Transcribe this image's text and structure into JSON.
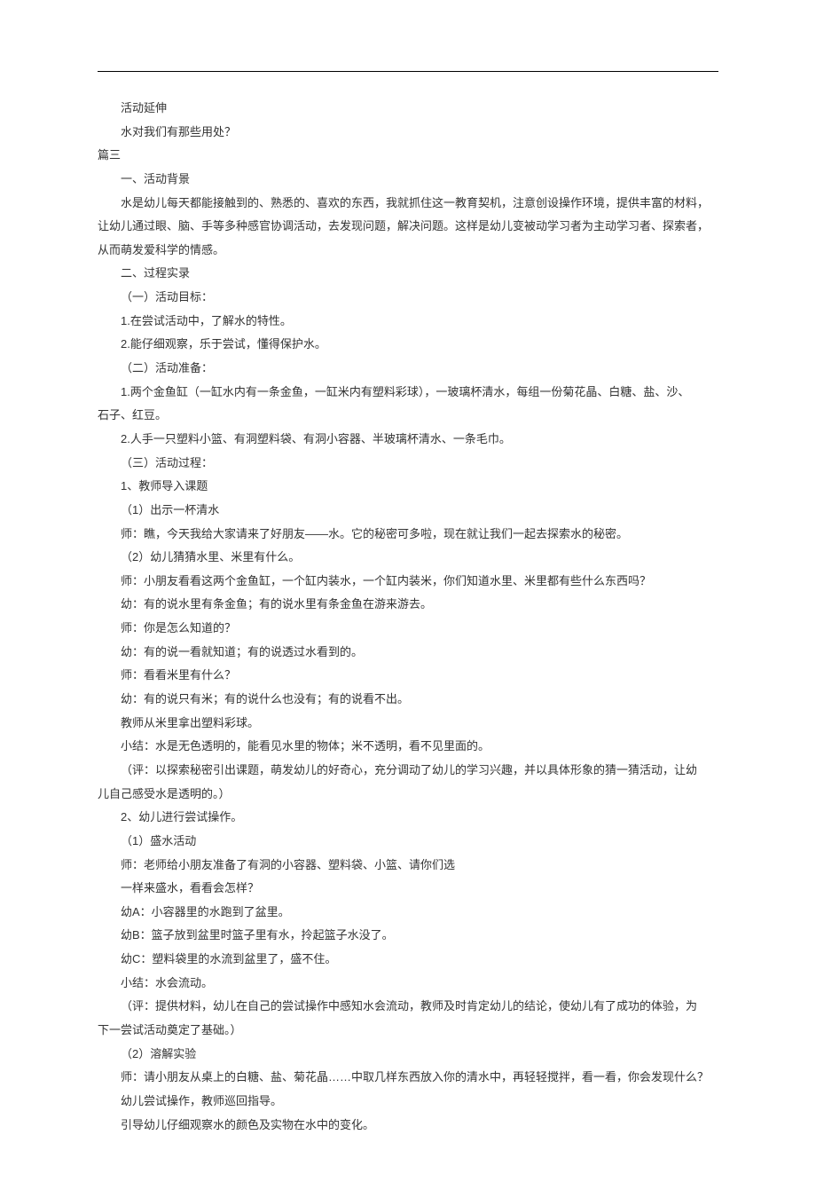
{
  "lines": [
    {
      "cls": "indent1",
      "key": "l0",
      "text": "活动延伸"
    },
    {
      "cls": "indent1",
      "key": "l1",
      "text": "水对我们有那些用处？"
    },
    {
      "cls": "indent0",
      "key": "l2",
      "text": "篇三"
    },
    {
      "cls": "indent1",
      "key": "l3",
      "text": "一、活动背景"
    },
    {
      "cls": "indent1",
      "key": "l4",
      "text": "水是幼儿每天都能接触到的、熟悉的、喜欢的东西，我就抓住这一教育契机，注意创设操作环境，提供丰富的材料，"
    },
    {
      "cls": "indent0",
      "key": "l5",
      "text": "让幼儿通过眼、脑、手等多种感官协调活动，去发现问题，解决问题。这样是幼儿变被动学习者为主动学习者、探索者，"
    },
    {
      "cls": "indent0",
      "key": "l6",
      "text": "从而萌发爱科学的情感。"
    },
    {
      "cls": "indent1",
      "key": "l7",
      "text": "二、过程实录"
    },
    {
      "cls": "indent1",
      "key": "l8",
      "text": "（一）活动目标："
    },
    {
      "cls": "indent1",
      "key": "l9",
      "text": "1.在尝试活动中，了解水的特性。"
    },
    {
      "cls": "indent1",
      "key": "l10",
      "text": "2.能仔细观察，乐于尝试，懂得保护水。"
    },
    {
      "cls": "indent1",
      "key": "l11",
      "text": "（二）活动准备："
    },
    {
      "cls": "indent1",
      "key": "l12",
      "text": "1.两个金鱼缸（一缸水内有一条金鱼，一缸米内有塑料彩球），一玻璃杯清水，每组一份菊花晶、白糖、盐、沙、"
    },
    {
      "cls": "indent0",
      "key": "l13",
      "text": "石子、红豆。"
    },
    {
      "cls": "indent1",
      "key": "l14",
      "text": "2.人手一只塑料小篮、有洞塑料袋、有洞小容器、半玻璃杯清水、一条毛巾。"
    },
    {
      "cls": "indent1",
      "key": "l15",
      "text": "（三）活动过程："
    },
    {
      "cls": "indent1",
      "key": "l16",
      "text": "1、教师导入课题"
    },
    {
      "cls": "indent1",
      "key": "l17",
      "text": "（1）出示一杯清水"
    },
    {
      "cls": "indent1",
      "key": "l18",
      "text": "师：瞧，今天我给大家请来了好朋友——水。它的秘密可多啦，现在就让我们一起去探索水的秘密。"
    },
    {
      "cls": "indent1",
      "key": "l19",
      "text": "（2）幼儿猜猜水里、米里有什么。"
    },
    {
      "cls": "indent1",
      "key": "l20",
      "text": "师：小朋友看看这两个金鱼缸，一个缸内装水，一个缸内装米，你们知道水里、米里都有些什么东西吗？"
    },
    {
      "cls": "indent1",
      "key": "l21",
      "text": "幼：有的说水里有条金鱼；有的说水里有条金鱼在游来游去。"
    },
    {
      "cls": "indent1",
      "key": "l22",
      "text": "师：你是怎么知道的？"
    },
    {
      "cls": "indent1",
      "key": "l23",
      "text": "幼：有的说一看就知道；有的说透过水看到的。"
    },
    {
      "cls": "indent1",
      "key": "l24",
      "text": "师：看看米里有什么？"
    },
    {
      "cls": "indent1",
      "key": "l25",
      "text": "幼：有的说只有米；有的说什么也没有；有的说看不出。"
    },
    {
      "cls": "indent1",
      "key": "l26",
      "text": "教师从米里拿出塑料彩球。"
    },
    {
      "cls": "indent1",
      "key": "l27",
      "text": "小结：水是无色透明的，能看见水里的物体；米不透明，看不见里面的。"
    },
    {
      "cls": "indent1",
      "key": "l28",
      "text": "（评：以探索秘密引出课题，萌发幼儿的好奇心，充分调动了幼儿的学习兴趣，并以具体形象的猜一猜活动，让幼"
    },
    {
      "cls": "indent0",
      "key": "l29",
      "text": "儿自己感受水是透明的。）"
    },
    {
      "cls": "indent1",
      "key": "l30",
      "text": "2、幼儿进行尝试操作。"
    },
    {
      "cls": "indent1",
      "key": "l31",
      "text": "（1）盛水活动"
    },
    {
      "cls": "indent1",
      "key": "l32",
      "text": "师：老师给小朋友准备了有洞的小容器、塑料袋、小篮、请你们选"
    },
    {
      "cls": "indent1",
      "key": "l33",
      "text": "一样来盛水，看看会怎样？"
    },
    {
      "cls": "indent1",
      "key": "l34",
      "text": "幼A：小容器里的水跑到了盆里。"
    },
    {
      "cls": "indent1",
      "key": "l35",
      "text": "幼B：篮子放到盆里时篮子里有水，拎起篮子水没了。"
    },
    {
      "cls": "indent1",
      "key": "l36",
      "text": "幼C：塑料袋里的水流到盆里了，盛不住。"
    },
    {
      "cls": "indent1",
      "key": "l37",
      "text": "小结：水会流动。"
    },
    {
      "cls": "indent1",
      "key": "l38",
      "text": "（评：提供材料，幼儿在自己的尝试操作中感知水会流动，教师及时肯定幼儿的结论，使幼儿有了成功的体验，为"
    },
    {
      "cls": "indent0",
      "key": "l39",
      "text": "下一尝试活动奠定了基础。）"
    },
    {
      "cls": "indent1",
      "key": "l40",
      "text": "（2）溶解实验"
    },
    {
      "cls": "indent1",
      "key": "l41",
      "text": "师：请小朋友从桌上的白糖、盐、菊花晶……中取几样东西放入你的清水中，再轻轻搅拌，看一看，你会发现什么？"
    },
    {
      "cls": "indent1",
      "key": "l42",
      "text": "幼儿尝试操作，教师巡回指导。"
    },
    {
      "cls": "indent1",
      "key": "l43",
      "text": "引导幼儿仔细观察水的颜色及实物在水中的变化。"
    }
  ]
}
